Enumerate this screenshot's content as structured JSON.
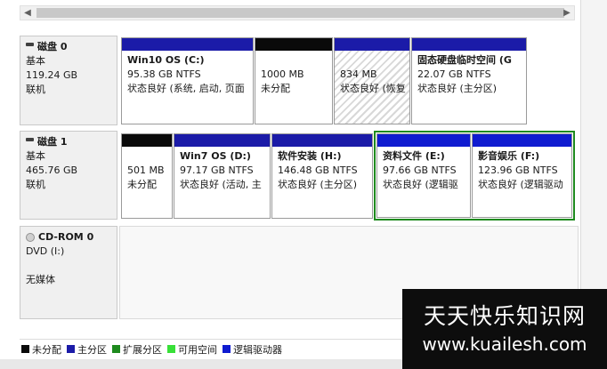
{
  "disks": [
    {
      "name": "磁盘 0",
      "type": "基本",
      "size": "119.24 GB",
      "status": "联机"
    },
    {
      "name": "磁盘 1",
      "type": "基本",
      "size": "465.76 GB",
      "status": "联机"
    },
    {
      "name": "CD-ROM 0",
      "type": "DVD (I:)",
      "status": "无媒体"
    }
  ],
  "disk0_partitions": [
    {
      "title": "Win10 OS  (C:)",
      "size": "95.38 GB NTFS",
      "status": "状态良好 (系统, 启动, 页面"
    },
    {
      "title": "",
      "size": "1000 MB",
      "status": "未分配"
    },
    {
      "title": "",
      "size": "834 MB",
      "status": "状态良好 (恢复"
    },
    {
      "title": "固态硬盘临时空间  (G",
      "size": "22.07 GB NTFS",
      "status": "状态良好 (主分区)"
    }
  ],
  "disk1_partitions": [
    {
      "title": "",
      "size": "501 MB",
      "status": "未分配"
    },
    {
      "title": "Win7 OS  (D:)",
      "size": "97.17 GB NTFS",
      "status": "状态良好 (活动, 主"
    },
    {
      "title": "软件安装  (H:)",
      "size": "146.48 GB NTFS",
      "status": "状态良好 (主分区)"
    },
    {
      "title": "资料文件  (E:)",
      "size": "97.66 GB NTFS",
      "status": "状态良好 (逻辑驱"
    },
    {
      "title": "影音娱乐  (F:)",
      "size": "123.96 GB NTFS",
      "status": "状态良好 (逻辑驱动"
    }
  ],
  "legend": [
    {
      "label": "未分配",
      "color": "#0a0a0a"
    },
    {
      "label": "主分区",
      "color": "#1b1ba8"
    },
    {
      "label": "扩展分区",
      "color": "#1e8a1e"
    },
    {
      "label": "可用空间",
      "color": "#38e038"
    },
    {
      "label": "逻辑驱动器",
      "color": "#0f1bd0"
    }
  ],
  "watermark": {
    "line1": "天天快乐知识网",
    "line2": "www.kuailesh.com"
  }
}
